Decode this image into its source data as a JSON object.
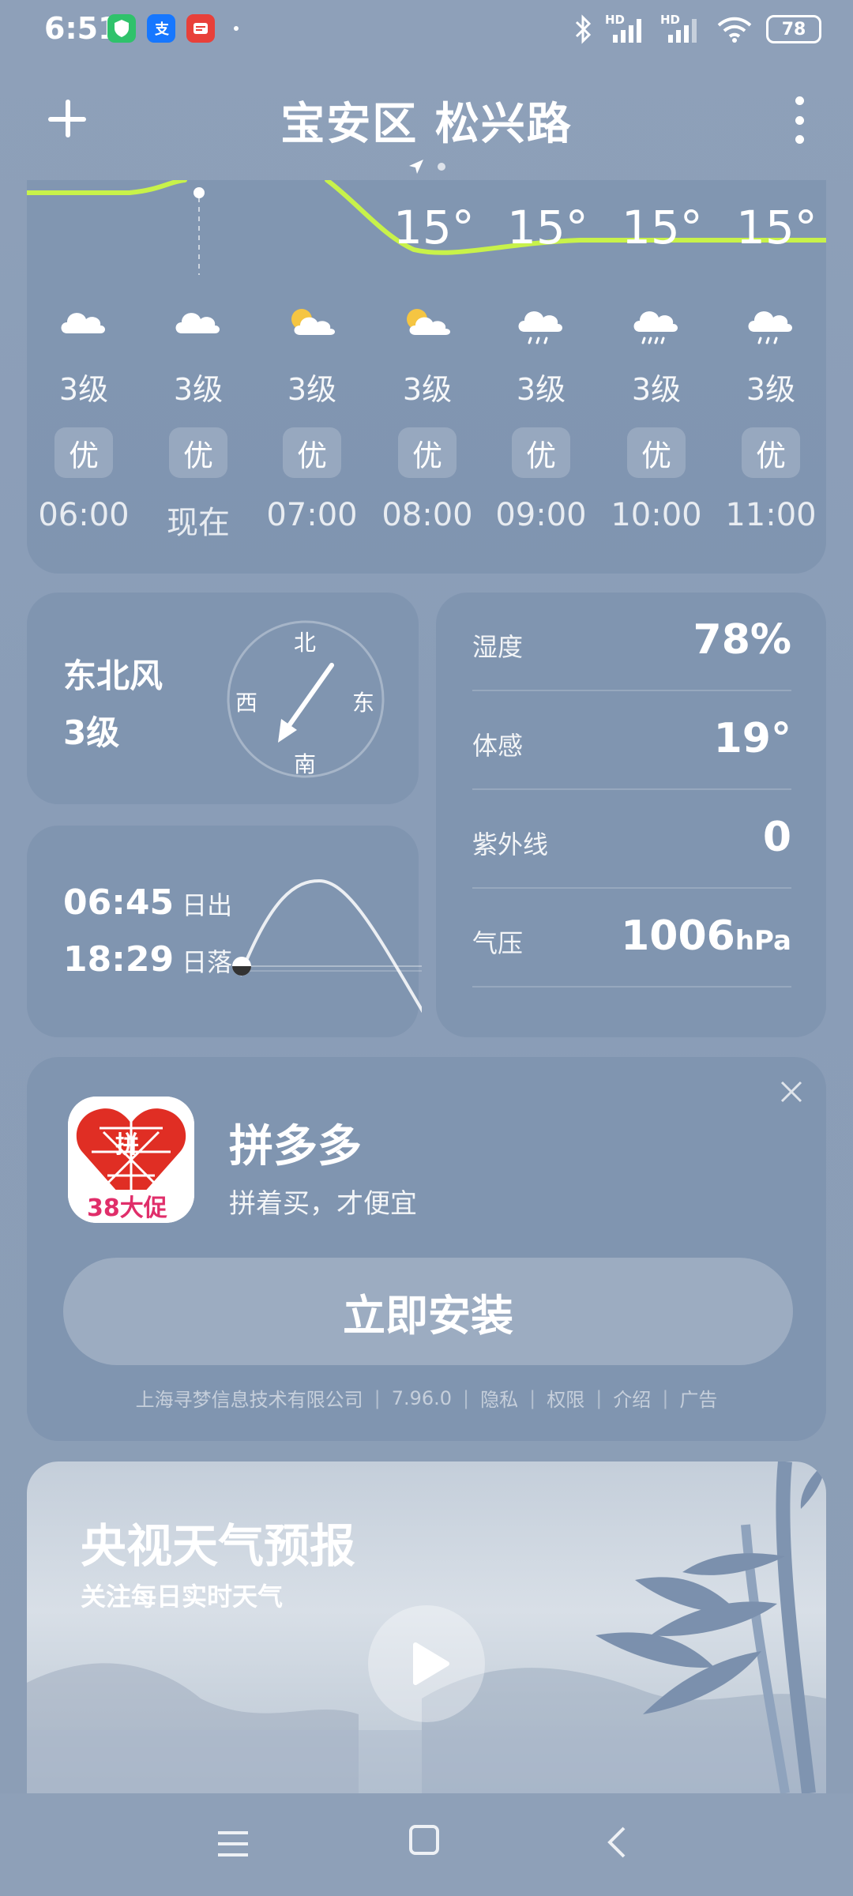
{
  "status_bar": {
    "time": "6:51",
    "hd_label_1": "HD",
    "hd_label_2": "HD",
    "battery": "78",
    "app_icons": [
      "shield-app-icon",
      "alipay-app-icon",
      "toutiao-app-icon"
    ]
  },
  "header": {
    "title": "宝安区 松兴路"
  },
  "hourly": {
    "temps": [
      "15°",
      "15°",
      "15°",
      "15°"
    ],
    "hours": [
      {
        "icon": "cloudy-icon",
        "wind": "3级",
        "aqi": "优",
        "time": "06:00"
      },
      {
        "icon": "cloudy-icon",
        "wind": "3级",
        "aqi": "优",
        "time": "现在"
      },
      {
        "icon": "partly-cloudy-icon",
        "wind": "3级",
        "aqi": "优",
        "time": "07:00"
      },
      {
        "icon": "partly-cloudy-icon",
        "wind": "3级",
        "aqi": "优",
        "time": "08:00"
      },
      {
        "icon": "light-rain-icon",
        "wind": "3级",
        "aqi": "优",
        "time": "09:00"
      },
      {
        "icon": "rain-icon",
        "wind": "3级",
        "aqi": "优",
        "time": "10:00"
      },
      {
        "icon": "light-rain-icon",
        "wind": "3级",
        "aqi": "优",
        "time": "11:00"
      }
    ]
  },
  "wind": {
    "direction": "东北风",
    "level": "3级",
    "compass": {
      "north": "北",
      "south": "南",
      "east": "东",
      "west": "西"
    }
  },
  "sun": {
    "sunrise_time": "06:45",
    "sunrise_label": "日出",
    "sunset_time": "18:29",
    "sunset_label": "日落"
  },
  "details": [
    {
      "label": "湿度",
      "value": "78%",
      "unit": ""
    },
    {
      "label": "体感",
      "value": "19°",
      "unit": ""
    },
    {
      "label": "紫外线",
      "value": "0",
      "unit": ""
    },
    {
      "label": "气压",
      "value": "1006",
      "unit": "hPa"
    }
  ],
  "ad": {
    "icon_badge_top": "拼",
    "icon_badge_bottom": "38大促",
    "title": "拼多多",
    "subtitle": "拼着买，才便宜",
    "install_label": "立即安装",
    "footer": {
      "company": "上海寻梦信息技术有限公司",
      "version": "7.96.0",
      "privacy": "隐私",
      "permissions": "权限",
      "intro": "介绍",
      "ad_tag": "广告"
    }
  },
  "video": {
    "title": "央视天气预报",
    "subtitle": "关注每日实时天气"
  },
  "colors": {
    "curve": "#c8f24a",
    "background": "#8ea0b9",
    "ad_red": "#e02e24"
  }
}
